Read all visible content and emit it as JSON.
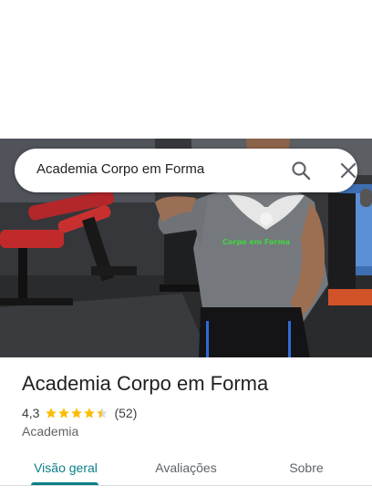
{
  "search": {
    "query": "Academia Corpo em Forma",
    "search_icon": "search-icon",
    "close_icon": "close-icon"
  },
  "hero": {
    "image": "gym-interior-photo",
    "shirt_text": "Corpo em Forma"
  },
  "place": {
    "name": "Academia Corpo em Forma",
    "rating": "4,3",
    "stars": 4.3,
    "review_count": "(52)",
    "category": "Academia"
  },
  "tabs": [
    {
      "label": "Visão geral",
      "active": true
    },
    {
      "label": "Avaliações",
      "active": false
    },
    {
      "label": "Sobre",
      "active": false
    }
  ],
  "colors": {
    "accent": "#0b7f89",
    "star": "#fbbc04",
    "text": "#202124"
  }
}
